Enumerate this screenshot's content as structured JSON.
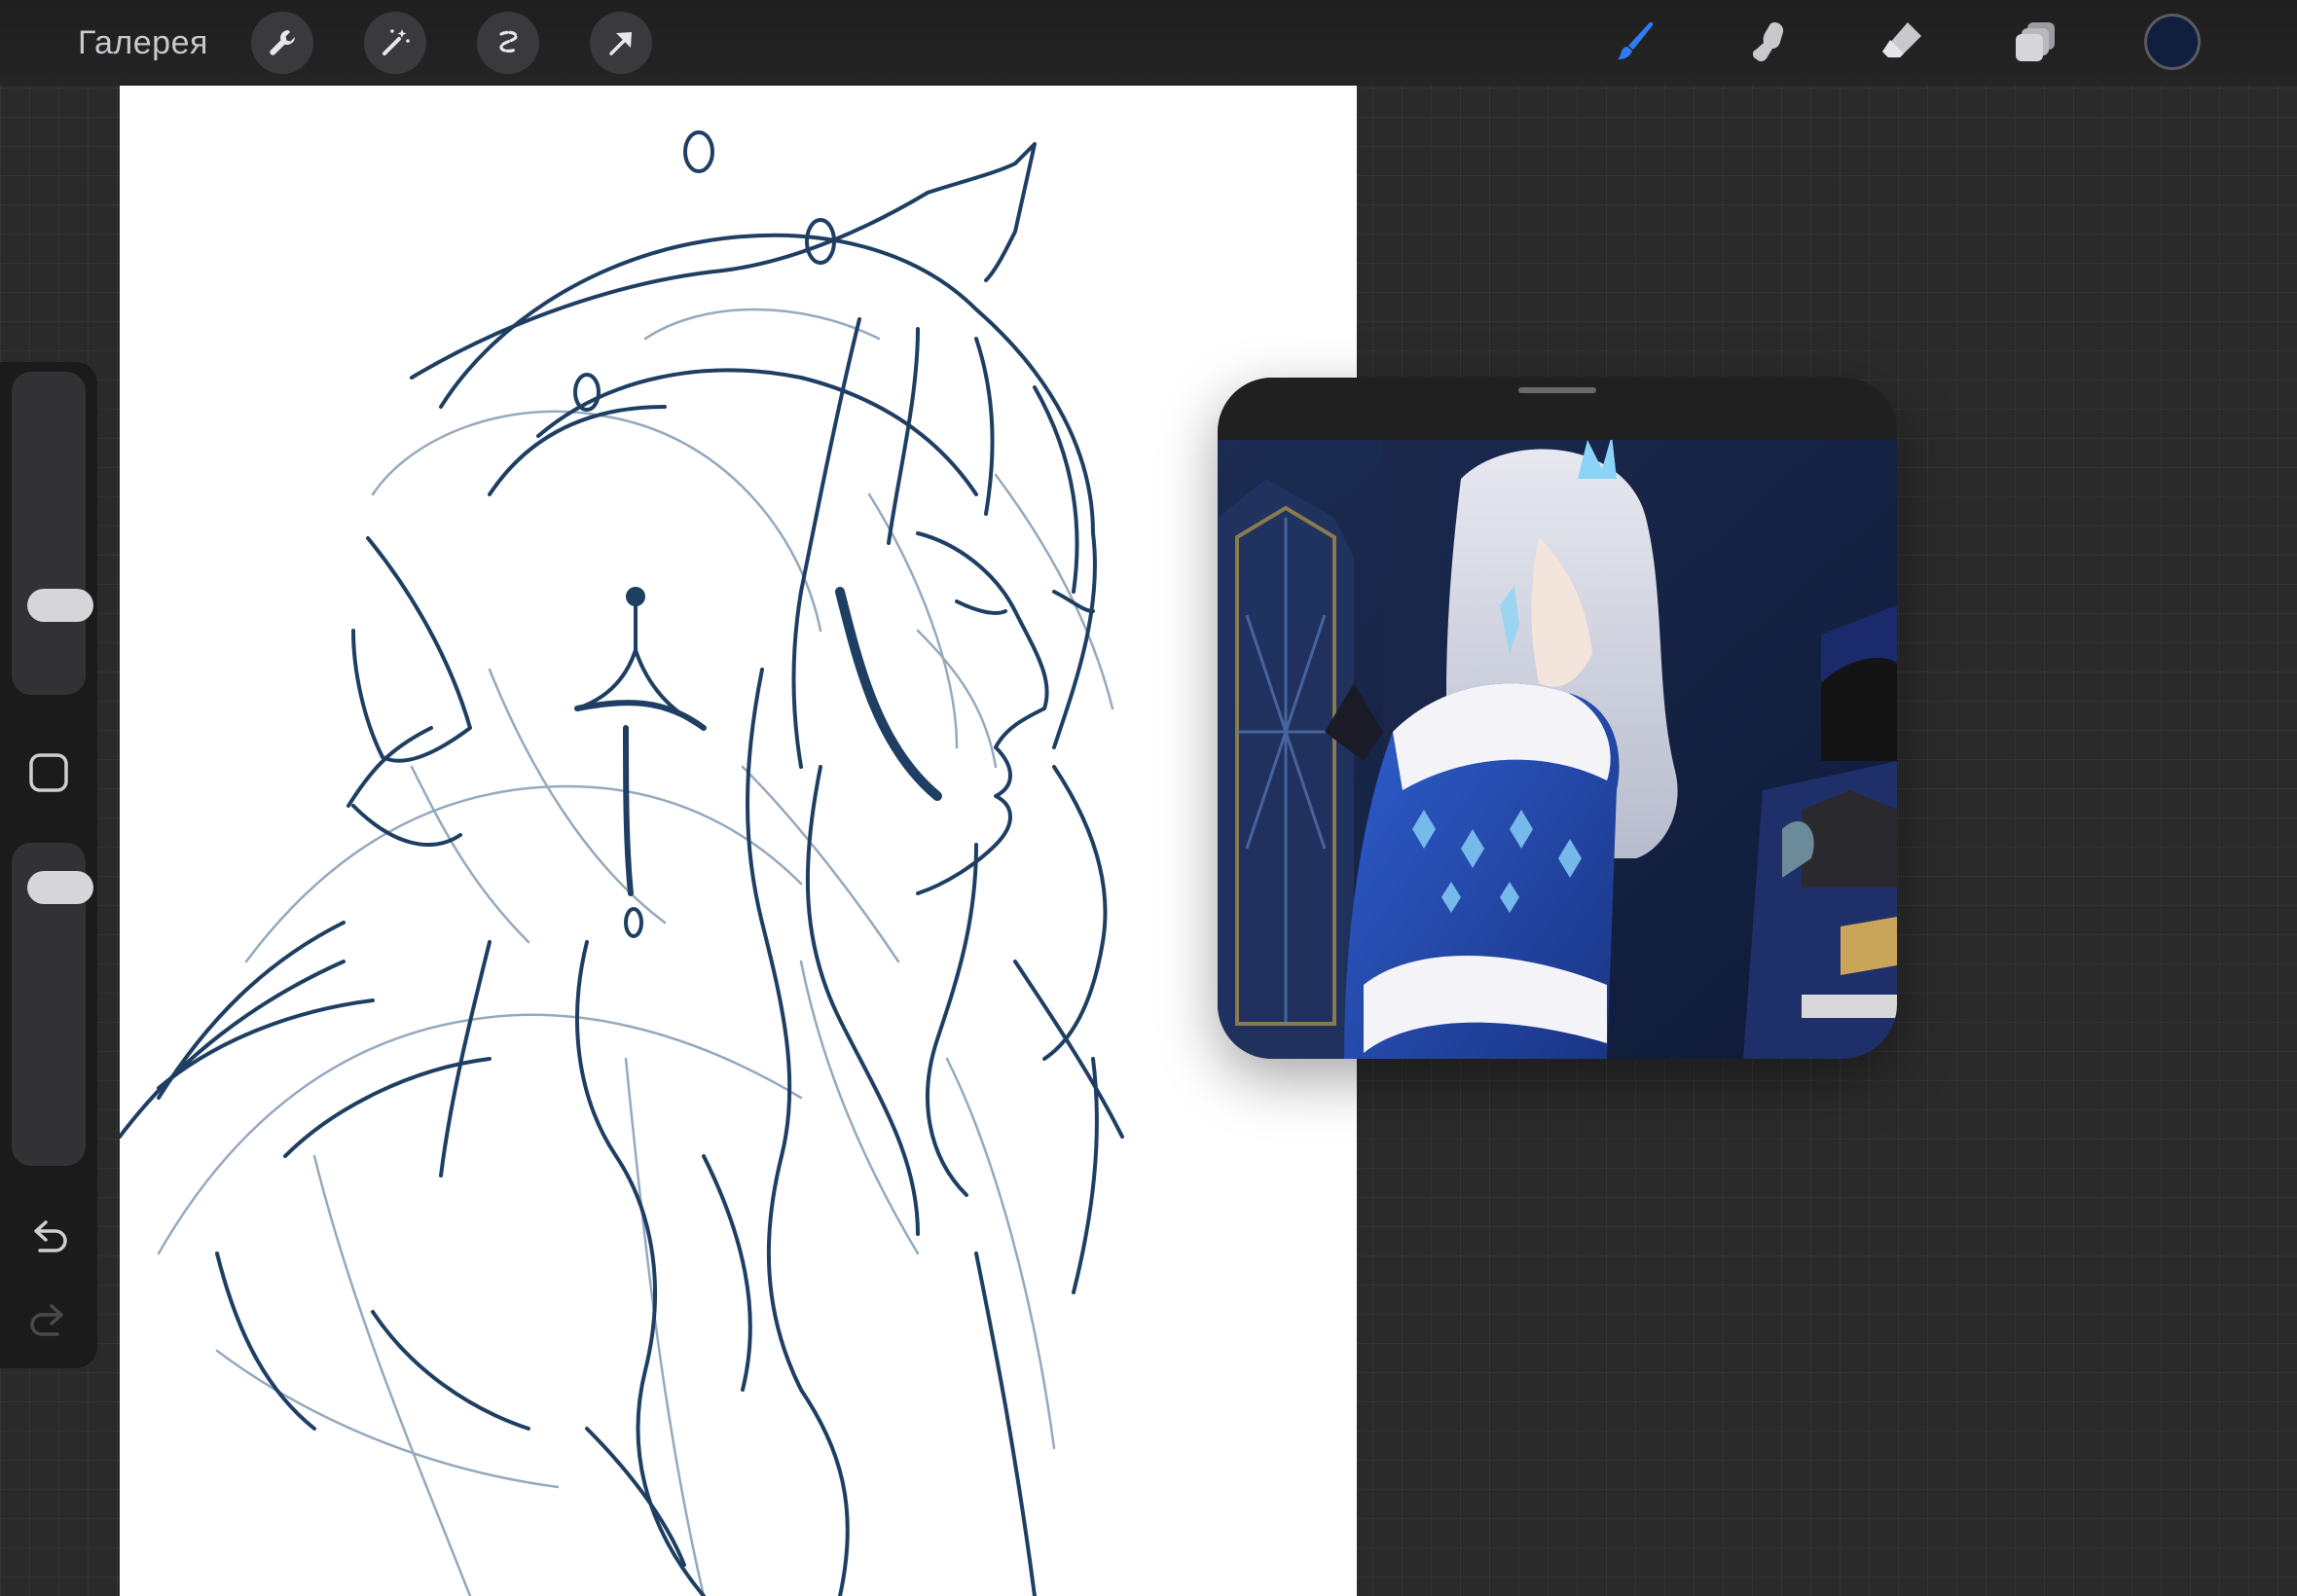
{
  "topbar": {
    "gallery_label": "Галерея",
    "left_tools": [
      {
        "icon": "wrench-icon"
      },
      {
        "icon": "magic-wand-icon"
      },
      {
        "icon": "selection-icon"
      },
      {
        "icon": "transform-arrow-icon"
      }
    ],
    "right_tools": [
      {
        "icon": "brush-icon",
        "active": true
      },
      {
        "icon": "smudge-icon",
        "active": false
      },
      {
        "icon": "eraser-icon",
        "active": false
      },
      {
        "icon": "layers-icon",
        "active": false
      }
    ],
    "active_color": "#0f1f3d"
  },
  "sidebar": {
    "brush_size_level": 0.24,
    "opacity_level": 0.92,
    "undo_icon": "undo-icon",
    "redo_icon": "redo-icon"
  },
  "reference_window": {
    "content": "reference-image"
  },
  "colors": {
    "sketch_stroke": "#1e3f63",
    "sketch_light": "#6f87a3",
    "accent_blue": "#2f7cf6"
  }
}
